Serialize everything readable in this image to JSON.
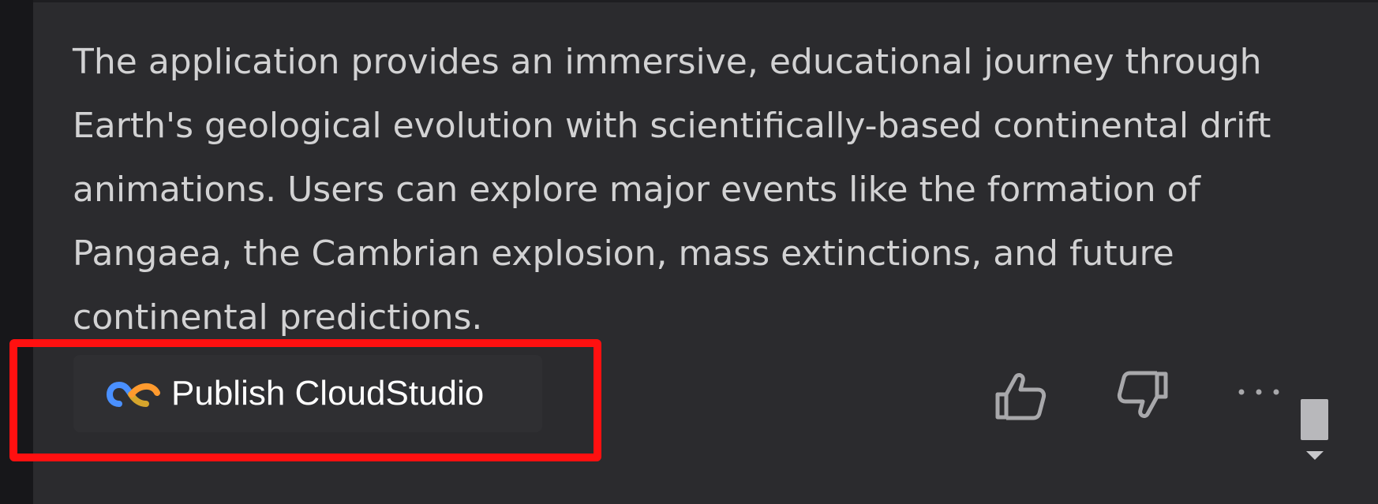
{
  "message": {
    "text": "The application provides an immersive, educational journey through Earth's geological evolution with scientifically-based continental drift animations. Users can explore major events like the formation of Pangaea, the Cambrian explosion, mass extinctions, and future continental predictions."
  },
  "actions": {
    "publish_label": "Publish CloudStudio",
    "publish_icon": "cloudstudio-logo-icon",
    "like_icon": "thumbs-up-icon",
    "dislike_icon": "thumbs-down-icon",
    "more_icon": "more-options-icon"
  },
  "colors": {
    "background": "#2b2b2e",
    "text": "#d2d2d3",
    "highlight": "#ff1010",
    "logo_blue": "#4a90ff",
    "logo_orange": "#ff9a2e"
  }
}
